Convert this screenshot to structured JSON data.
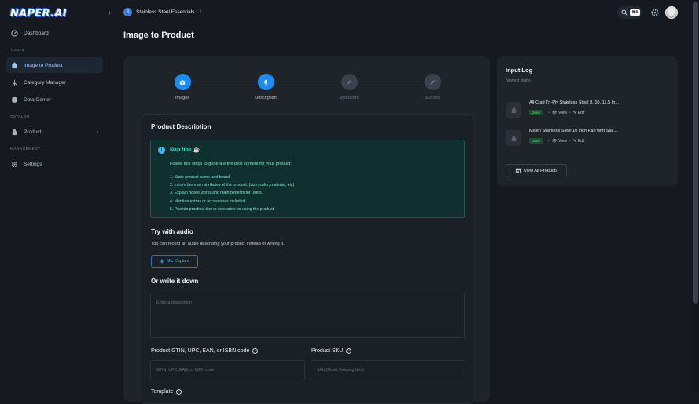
{
  "app": {
    "logo": "NAPER.AI"
  },
  "header": {
    "project_badge": "S",
    "project_name": "Stainless Steel Essentials",
    "search_shortcut": "⌘K"
  },
  "sidebar": {
    "top_items": [
      {
        "label": "Dashboard",
        "icon": "dashboard-icon"
      }
    ],
    "tools_label": "TOOLS",
    "tools": [
      {
        "label": "Image to Product",
        "icon": "image-product-icon",
        "active": true
      },
      {
        "label": "Category Manager",
        "icon": "category-tree-icon"
      },
      {
        "label": "Data Center",
        "icon": "database-icon"
      }
    ],
    "catalog_label": "CATALOG",
    "catalog": [
      {
        "label": "Product",
        "icon": "product-icon"
      }
    ],
    "management_label": "MANAGEMENT",
    "management": [
      {
        "label": "Settings",
        "icon": "gear-icon"
      }
    ]
  },
  "page": {
    "title": "Image to Product"
  },
  "stepper": {
    "steps": [
      {
        "label": "Images",
        "state": "done"
      },
      {
        "label": "Description",
        "state": "current"
      },
      {
        "label": "Variations",
        "state": "pending"
      },
      {
        "label": "Success",
        "state": "pending"
      }
    ]
  },
  "form": {
    "section_title": "Product Description",
    "tips": {
      "title": "Nap tips ☕",
      "intro": "Follow this steps to generate the best content for your product:",
      "items": [
        "1. State product name and brand.",
        "2. Inform the main attributes of the product. (size, color, material, etc)",
        "3. Explain how it works and main benefits for users.",
        "4. Mention extras or accessories included.",
        "5. Provide practical tips or scenarios for using the product."
      ]
    },
    "audio": {
      "title": "Try with audio",
      "desc": "You can record an audio describing your product instead of writing it.",
      "button": "Mic Capture"
    },
    "write": {
      "title": "Or write it down",
      "placeholder": "Enter a description"
    },
    "gtin": {
      "label": "Product GTIN, UPC, EAN, or ISBN code",
      "placeholder": "GTIN, UPC, EAN, or ISBN code"
    },
    "sku": {
      "label": "Product SKU",
      "placeholder": "SKU (Stock Keeping Unit)"
    },
    "template_label": "Template"
  },
  "input_log": {
    "title": "Input Log",
    "subtitle": "Newest drafts",
    "items": [
      {
        "name": "All-Clad Tri-Ply Stainless Steel 8, 10, 11.5 In...",
        "status": "Done",
        "view": "View",
        "edit": "Edit"
      },
      {
        "name": "Misen Stainless Steel 10 inch Pan with Stai...",
        "status": "Done",
        "view": "View",
        "edit": "Edit"
      }
    ],
    "view_all": "view All Products"
  },
  "colors": {
    "accent": "#1d8cf0",
    "tips_bg": "#10302f",
    "tips_text": "#7fe3d6",
    "done_badge": "#59d98a"
  }
}
